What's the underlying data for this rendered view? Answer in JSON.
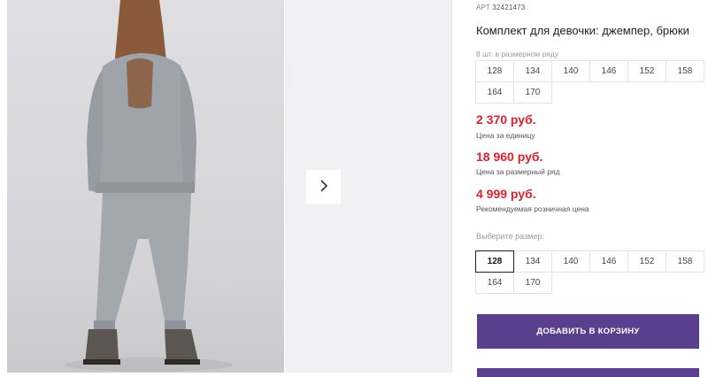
{
  "product": {
    "art_label": "АРТ",
    "art_number": "32421473",
    "title": "Комплект для девочки: джемпер, брюки",
    "pack_note": "8 шт. в размерном ряду",
    "pack_sizes": [
      "128",
      "134",
      "140",
      "146",
      "152",
      "158",
      "164",
      "170"
    ]
  },
  "prices": [
    {
      "value": "2 370 руб.",
      "label": "Цена за единицу"
    },
    {
      "value": "18 960 руб.",
      "label": "Цена за размерный ряд"
    },
    {
      "value": "4 999 руб.",
      "label": "Рекомендуемая розничная цена"
    }
  ],
  "size_picker": {
    "label": "Выберите размер:",
    "selected": "128",
    "options": [
      "128",
      "134",
      "140",
      "146",
      "152",
      "158",
      "164",
      "170"
    ]
  },
  "actions": {
    "add_to_cart": "ДОБАВИТЬ В КОРЗИНУ"
  },
  "gallery": {
    "next_icon": "chevron-right-icon"
  },
  "colors": {
    "accent": "#5a3f8f",
    "price": "#d8222f"
  }
}
